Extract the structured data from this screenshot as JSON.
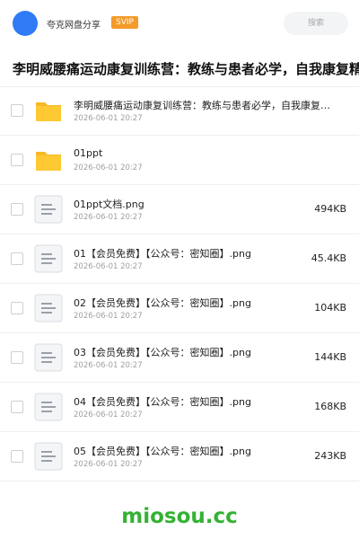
{
  "header": {
    "app_name": "夸克网盘分享",
    "badge": "SVIP",
    "search_placeholder": "搜索"
  },
  "page_title": "李明威腰痛运动康复训练营：教练与患者必学，自我康复精",
  "files": [
    {
      "type": "folder",
      "name": "李明威腰痛运动康复训练营：教练与患者必学，自我康复精华",
      "time": "2026-06-01 20:27",
      "size": ""
    },
    {
      "type": "folder",
      "name": "01ppt",
      "time": "2026-06-01 20:27",
      "size": ""
    },
    {
      "type": "file",
      "name": "01ppt文档.png",
      "time": "2026-06-01 20:27",
      "size": "494KB"
    },
    {
      "type": "file",
      "name": "01【会员免费】【公众号：密知圈】.png",
      "time": "2026-06-01 20:27",
      "size": "45.4KB"
    },
    {
      "type": "file",
      "name": "02【会员免费】【公众号：密知圈】.png",
      "time": "2026-06-01 20:27",
      "size": "104KB"
    },
    {
      "type": "file",
      "name": "03【会员免费】【公众号：密知圈】.png",
      "time": "2026-06-01 20:27",
      "size": "144KB"
    },
    {
      "type": "file",
      "name": "04【会员免费】【公众号：密知圈】.png",
      "time": "2026-06-01 20:27",
      "size": "168KB"
    },
    {
      "type": "file",
      "name": "05【会员免费】【公众号：密知圈】.png",
      "time": "2026-06-01 20:27",
      "size": "243KB"
    }
  ],
  "watermark": "miosou.cc",
  "colors": {
    "accent": "#2f7bf6",
    "badge": "#f39a2a",
    "folder": "#ffc933",
    "watermark": "#33b233"
  }
}
